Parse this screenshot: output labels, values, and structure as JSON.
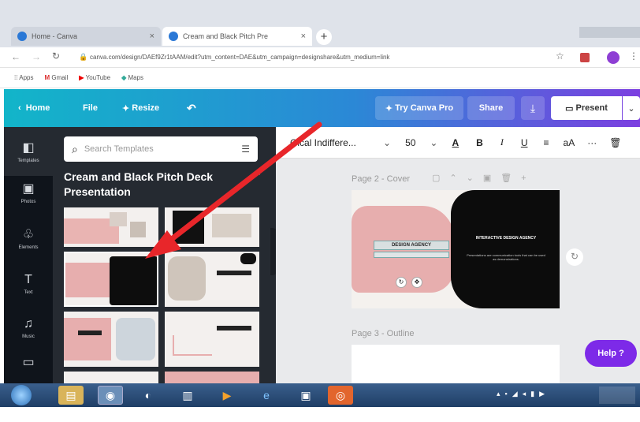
{
  "browser": {
    "tabs": [
      {
        "title": "Home - Canva",
        "active": false
      },
      {
        "title": "Cream and Black Pitch Pre",
        "active": true
      }
    ],
    "new_tab": "+",
    "url": "canva.com/design/DAEf9Zr1tAAM/edit?utm_content=DAE&utm_campaign=designshare&utm_medium=link",
    "bookmarks": [
      "Apps",
      "Gmail",
      "YouTube",
      "Maps"
    ]
  },
  "header": {
    "home": "Home",
    "file": "File",
    "resize": "Resize",
    "try_pro": "Try Canva Pro",
    "share": "Share",
    "present": "Present"
  },
  "rail": [
    {
      "label": "Templates",
      "icon": "templates-icon",
      "glyph": "◧"
    },
    {
      "label": "Photos",
      "icon": "photos-icon",
      "glyph": "▣"
    },
    {
      "label": "Elements",
      "icon": "elements-icon",
      "glyph": "♧"
    },
    {
      "label": "Text",
      "icon": "text-icon",
      "glyph": "T"
    },
    {
      "label": "Music",
      "icon": "music-icon",
      "glyph": "♫"
    },
    {
      "label": "Videos",
      "icon": "video-icon",
      "glyph": "▭"
    }
  ],
  "panel": {
    "search_placeholder": "Search Templates",
    "title": "Cream and Black Pitch Deck Presentation"
  },
  "toolbar": {
    "font": "Gical Indiffere...",
    "size": "50",
    "bold": "B",
    "italic": "I",
    "underline": "U",
    "case": "aA",
    "more": "···"
  },
  "canvas": {
    "page2_label": "Page 2 - Cover",
    "page3_label": "Page 3 - Outline",
    "slide_left_text": "DESIGN AGENCY",
    "slide_right_title": "INTERACTIVE DESIGN AGENCY",
    "slide_right_body": "Presentations are communication tools that can be used as demonstrations.",
    "help": "Help ?"
  },
  "colors": {
    "accent_red": "#e8262a",
    "pink": "#e7aeae",
    "panel_bg": "#252a31",
    "rail_bg": "#0f141b"
  }
}
